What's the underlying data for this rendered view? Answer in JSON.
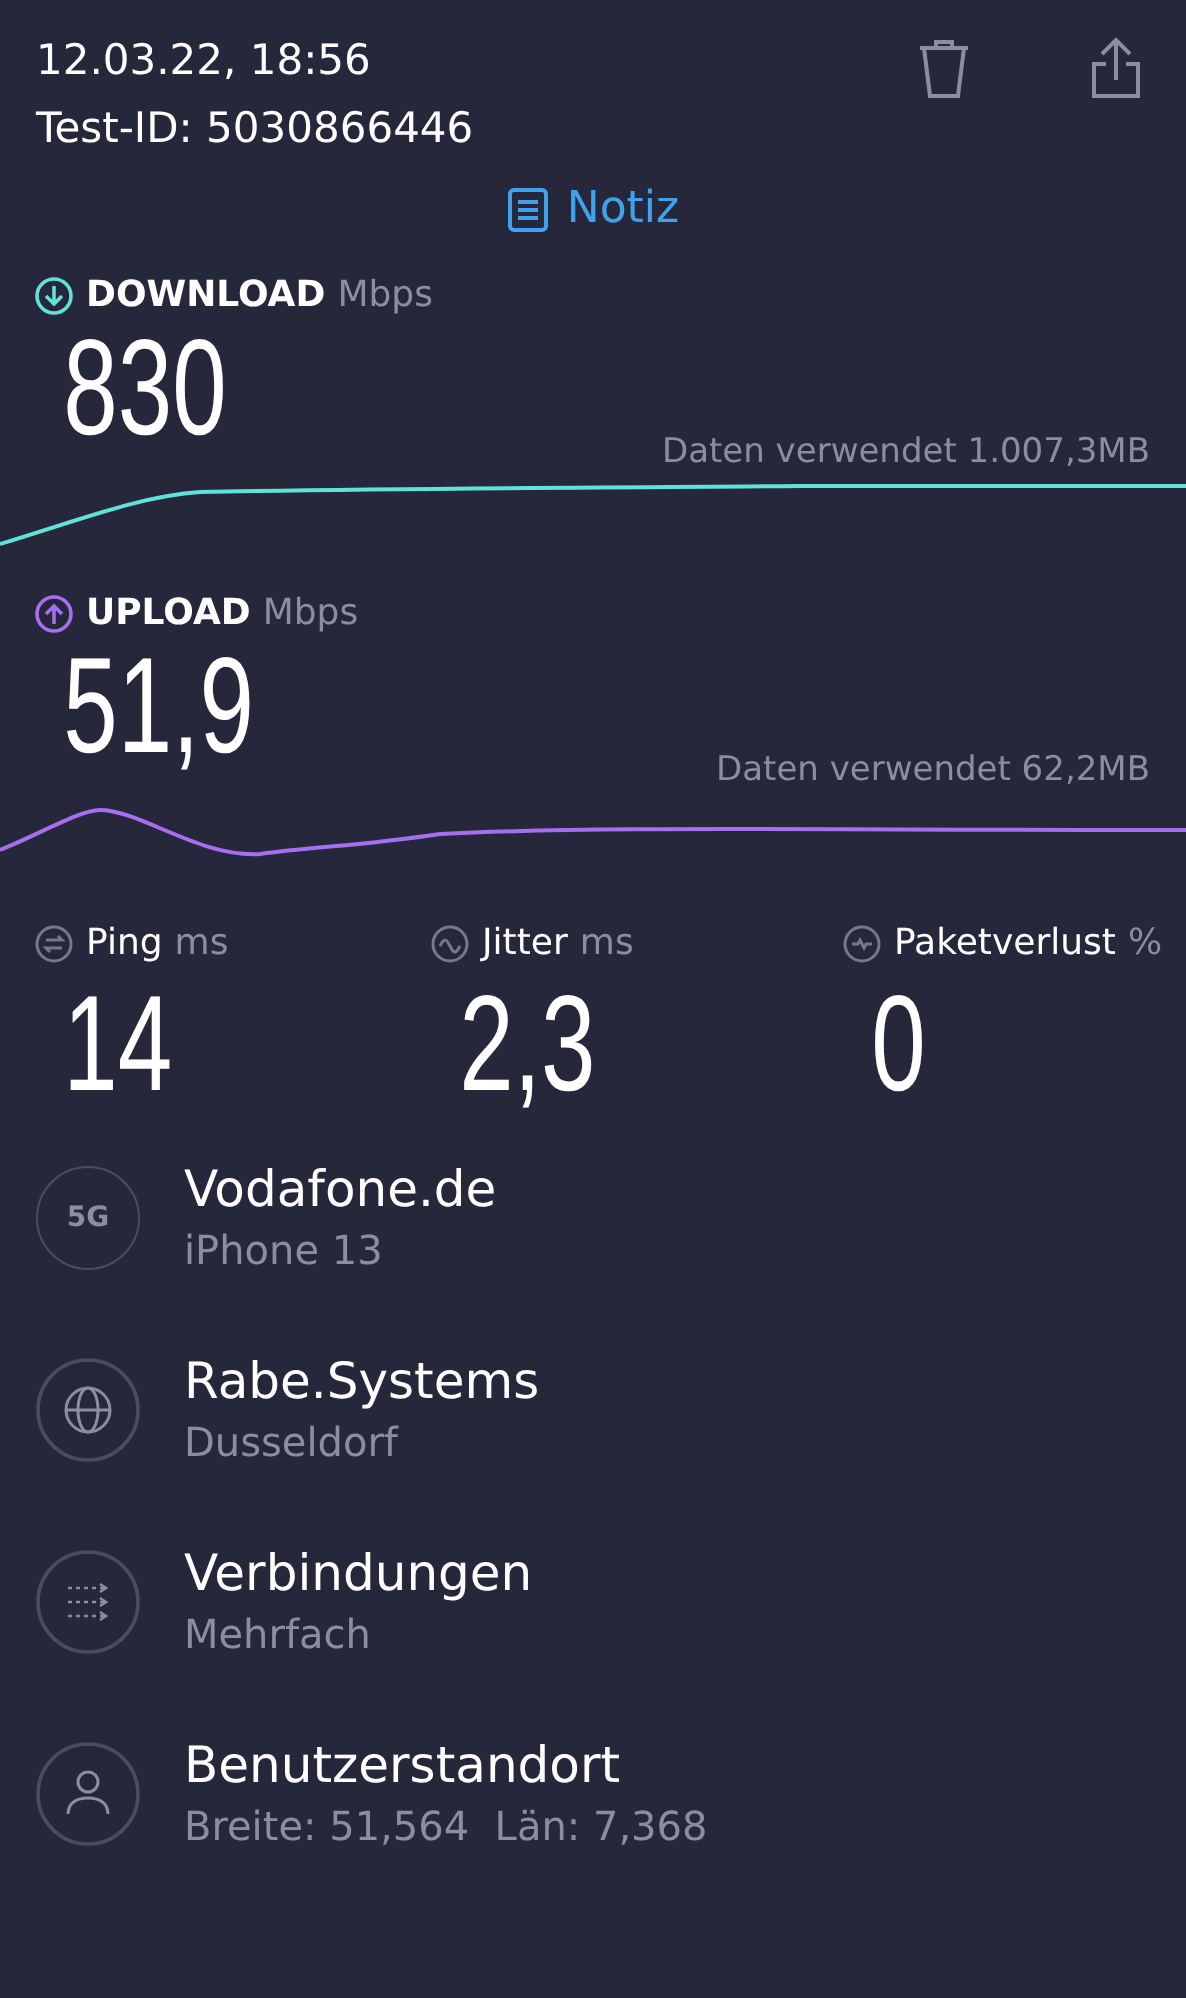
{
  "header": {
    "date": "12.03.22, 18:56",
    "test_id": "Test-ID: 5030866446"
  },
  "note_link": {
    "label": "Notiz"
  },
  "speeds": [
    {
      "kind": "download",
      "label": "DOWNLOAD",
      "unit": "Mbps",
      "value": "830",
      "data_used": "Daten verwendet 1.007,3MB",
      "color": "#5fe3d8"
    },
    {
      "kind": "upload",
      "label": "UPLOAD",
      "unit": "Mbps",
      "value": "51,9",
      "data_used": "Daten verwendet 62,2MB",
      "color": "#a66ef0"
    }
  ],
  "metrics": [
    {
      "kind": "ping",
      "label": "Ping",
      "unit": "ms",
      "value": "14"
    },
    {
      "kind": "jitter",
      "label": "Jitter",
      "unit": "ms",
      "value": "2,3"
    },
    {
      "kind": "loss",
      "label": "Paketverlust",
      "unit": "%",
      "value": "0"
    }
  ],
  "info_rows": [
    {
      "kind": "network",
      "badge": "5G",
      "title": "Vodafone.de",
      "subtitle": "iPhone 13"
    },
    {
      "kind": "server",
      "title": "Rabe.Systems",
      "subtitle": "Dusseldorf"
    },
    {
      "kind": "connections",
      "title": "Verbindungen",
      "subtitle": "Mehrfach"
    },
    {
      "kind": "location",
      "title": "Benutzerstandort",
      "subtitle": "Breite: 51,564  Län: 7,368"
    }
  ]
}
